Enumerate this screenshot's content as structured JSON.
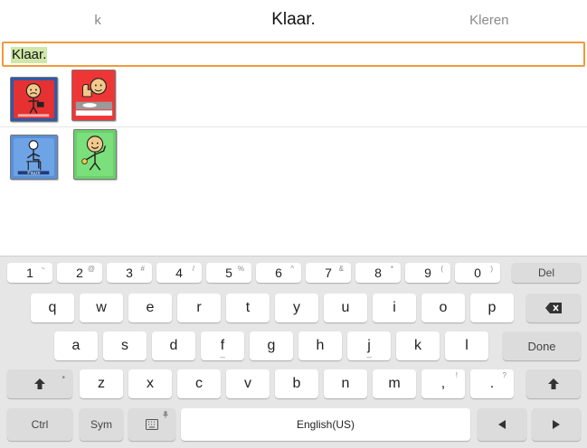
{
  "suggestions": {
    "left": "k",
    "center": "Klaar.",
    "right": "Kleren"
  },
  "input": {
    "text": "Klaar."
  },
  "tiles": [
    {
      "name": "pictogram-tile-1",
      "caption": ""
    },
    {
      "name": "pictogram-tile-2",
      "caption": ""
    },
    {
      "name": "pictogram-tile-3",
      "caption": "Pauze"
    },
    {
      "name": "pictogram-tile-4",
      "caption": ""
    }
  ],
  "keyboard": {
    "numbers": [
      {
        "k": "1",
        "s": "~"
      },
      {
        "k": "2",
        "s": "@"
      },
      {
        "k": "3",
        "s": "#"
      },
      {
        "k": "4",
        "s": "/"
      },
      {
        "k": "5",
        "s": "%"
      },
      {
        "k": "6",
        "s": "^"
      },
      {
        "k": "7",
        "s": "&"
      },
      {
        "k": "8",
        "s": "*"
      },
      {
        "k": "9",
        "s": "("
      },
      {
        "k": "0",
        "s": ")"
      }
    ],
    "del": "Del",
    "row1": [
      "q",
      "w",
      "e",
      "r",
      "t",
      "y",
      "u",
      "i",
      "o",
      "p"
    ],
    "row2": [
      "a",
      "s",
      "d",
      "f",
      "g",
      "h",
      "j",
      "k",
      "l"
    ],
    "done": "Done",
    "row3": [
      "z",
      "x",
      "c",
      "v",
      "b",
      "n",
      "m"
    ],
    "comma": ",",
    "comma_sup": "!",
    "period": ".",
    "period_sup": "?",
    "ctrl": "Ctrl",
    "sym": "Sym",
    "space": "English(US)",
    "colors": {
      "bg": "#e6e6e6",
      "key": "#ffffff",
      "func": "#dcdcdc",
      "accent": "#f29a3b",
      "highlight": "#cfe7a7"
    }
  }
}
